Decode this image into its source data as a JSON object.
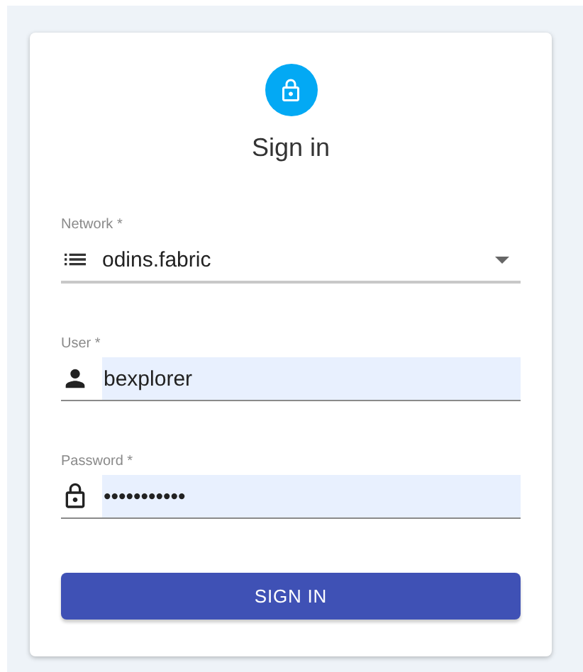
{
  "title": "Sign in",
  "fields": [
    {
      "kind": "select",
      "label": "Network *",
      "value": "odins.fabric"
    },
    {
      "kind": "text",
      "label": "User *",
      "value": "bexplorer",
      "autofilled": true
    },
    {
      "kind": "password",
      "label": "Password *",
      "value": "•••••••••••",
      "autofilled": true
    }
  ],
  "button": "SIGN IN"
}
